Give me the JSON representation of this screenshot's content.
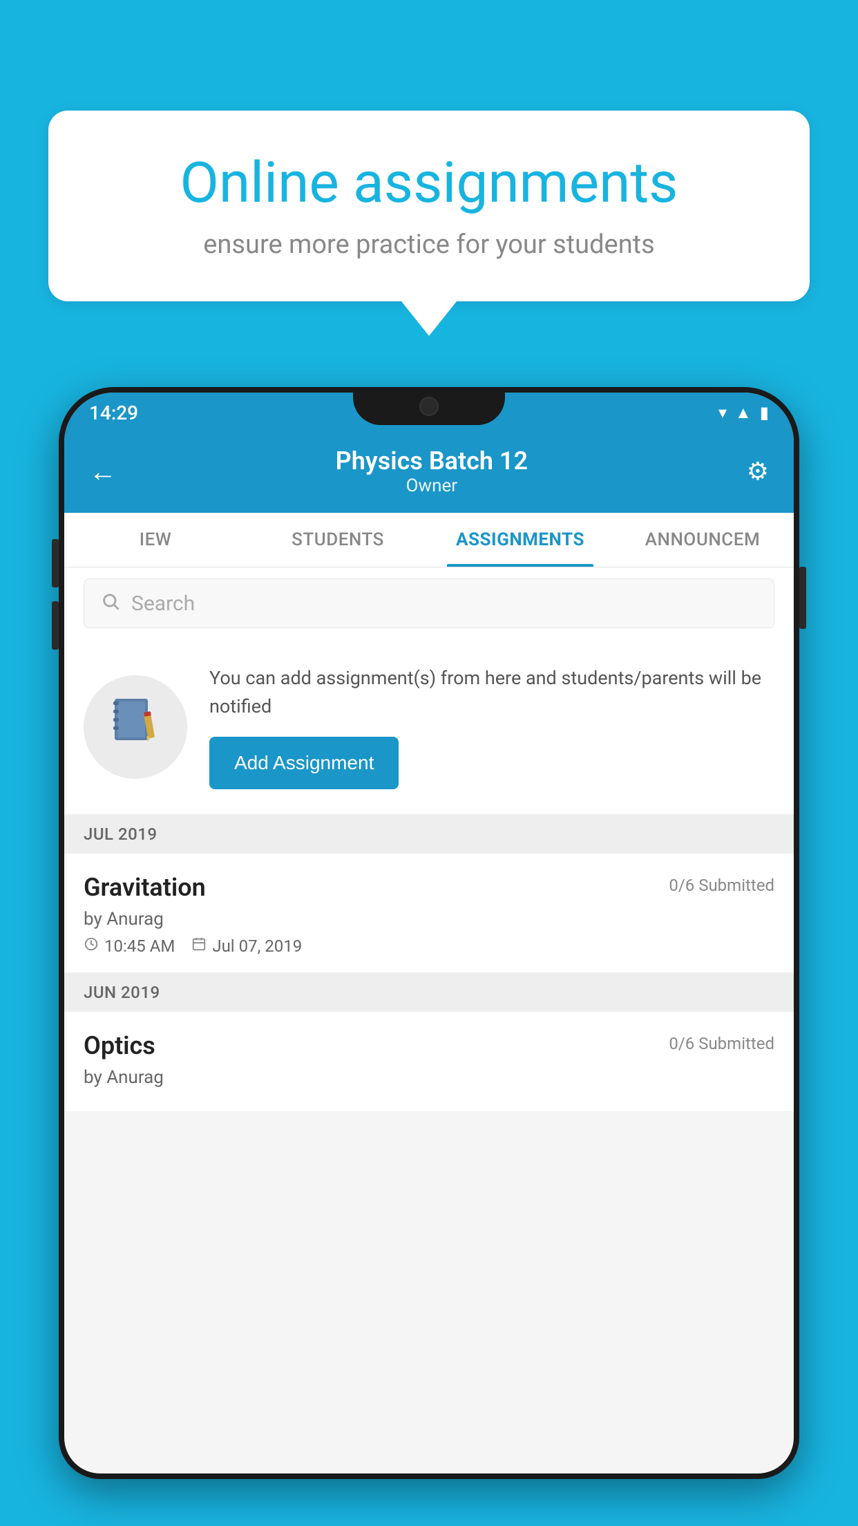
{
  "background_color": "#18b4e0",
  "bubble": {
    "title": "Online assignments",
    "subtitle": "ensure more practice for your students"
  },
  "phone": {
    "status_bar": {
      "time": "14:29",
      "icons": [
        "wifi",
        "signal",
        "battery"
      ]
    },
    "header": {
      "title": "Physics Batch 12",
      "subtitle": "Owner",
      "back_label": "←",
      "settings_label": "⚙"
    },
    "tabs": [
      {
        "label": "IEW",
        "active": false
      },
      {
        "label": "STUDENTS",
        "active": false
      },
      {
        "label": "ASSIGNMENTS",
        "active": true
      },
      {
        "label": "ANNOUNCEM",
        "active": false
      }
    ],
    "search": {
      "placeholder": "Search"
    },
    "info_card": {
      "description": "You can add assignment(s) from here and students/parents will be notified",
      "add_button_label": "Add Assignment"
    },
    "sections": [
      {
        "month_label": "JUL 2019",
        "assignments": [
          {
            "name": "Gravitation",
            "submitted": "0/6 Submitted",
            "by": "by Anurag",
            "time": "10:45 AM",
            "date": "Jul 07, 2019"
          }
        ]
      },
      {
        "month_label": "JUN 2019",
        "assignments": [
          {
            "name": "Optics",
            "submitted": "0/6 Submitted",
            "by": "by Anurag",
            "time": "",
            "date": ""
          }
        ]
      }
    ]
  }
}
